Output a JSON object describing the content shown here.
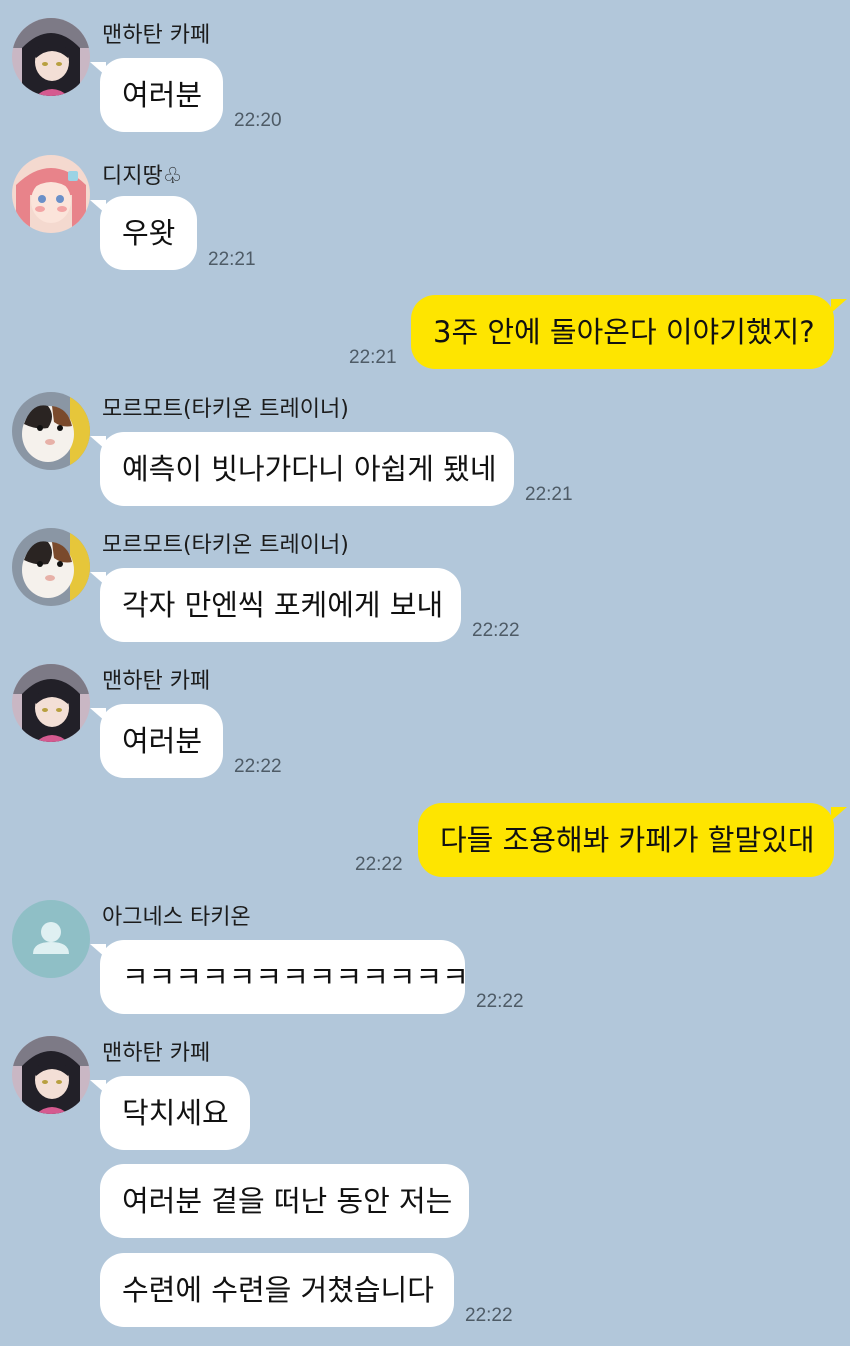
{
  "chat": {
    "messages": [
      {
        "sender": "맨하탄 카페",
        "text": "여러분",
        "time": "22:20"
      },
      {
        "sender": "디지땅♧",
        "text": "우왓",
        "time": "22:21"
      },
      {
        "sender": "me",
        "text": "3주 안에 돌아온다 이야기했지?",
        "time": "22:21"
      },
      {
        "sender": "모르모트(타키온 트레이너)",
        "text": "예측이 빗나가다니 아쉽게 됐네",
        "time": "22:21"
      },
      {
        "sender": "모르모트(타키온 트레이너)",
        "text": "각자 만엔씩 포케에게 보내",
        "time": "22:22"
      },
      {
        "sender": "맨하탄 카페",
        "text": "여러분",
        "time": "22:22"
      },
      {
        "sender": "me",
        "text": "다들 조용해봐 카페가 할말있대",
        "time": "22:22"
      },
      {
        "sender": "아그네스 타키온",
        "text": "ㅋㅋㅋㅋㅋㅋㅋㅋㅋㅋㅋㅋㅋ",
        "time": "22:22"
      },
      {
        "sender": "맨하탄 카페",
        "texts": [
          "닥치세요",
          "여러분 곁을 떠난 동안 저는",
          "수련에 수련을 거쳤습니다"
        ],
        "time": "22:22"
      }
    ]
  },
  "avatars": {
    "cafe": "anime-girl-dark-hair-avatar",
    "digitan": "anime-girl-pink-hair-avatar",
    "guineapig": "guinea-pig-avatar",
    "default": "default-person-avatar"
  },
  "colors": {
    "background": "#b2c7da",
    "my_bubble": "#fee500",
    "other_bubble": "#ffffff"
  }
}
